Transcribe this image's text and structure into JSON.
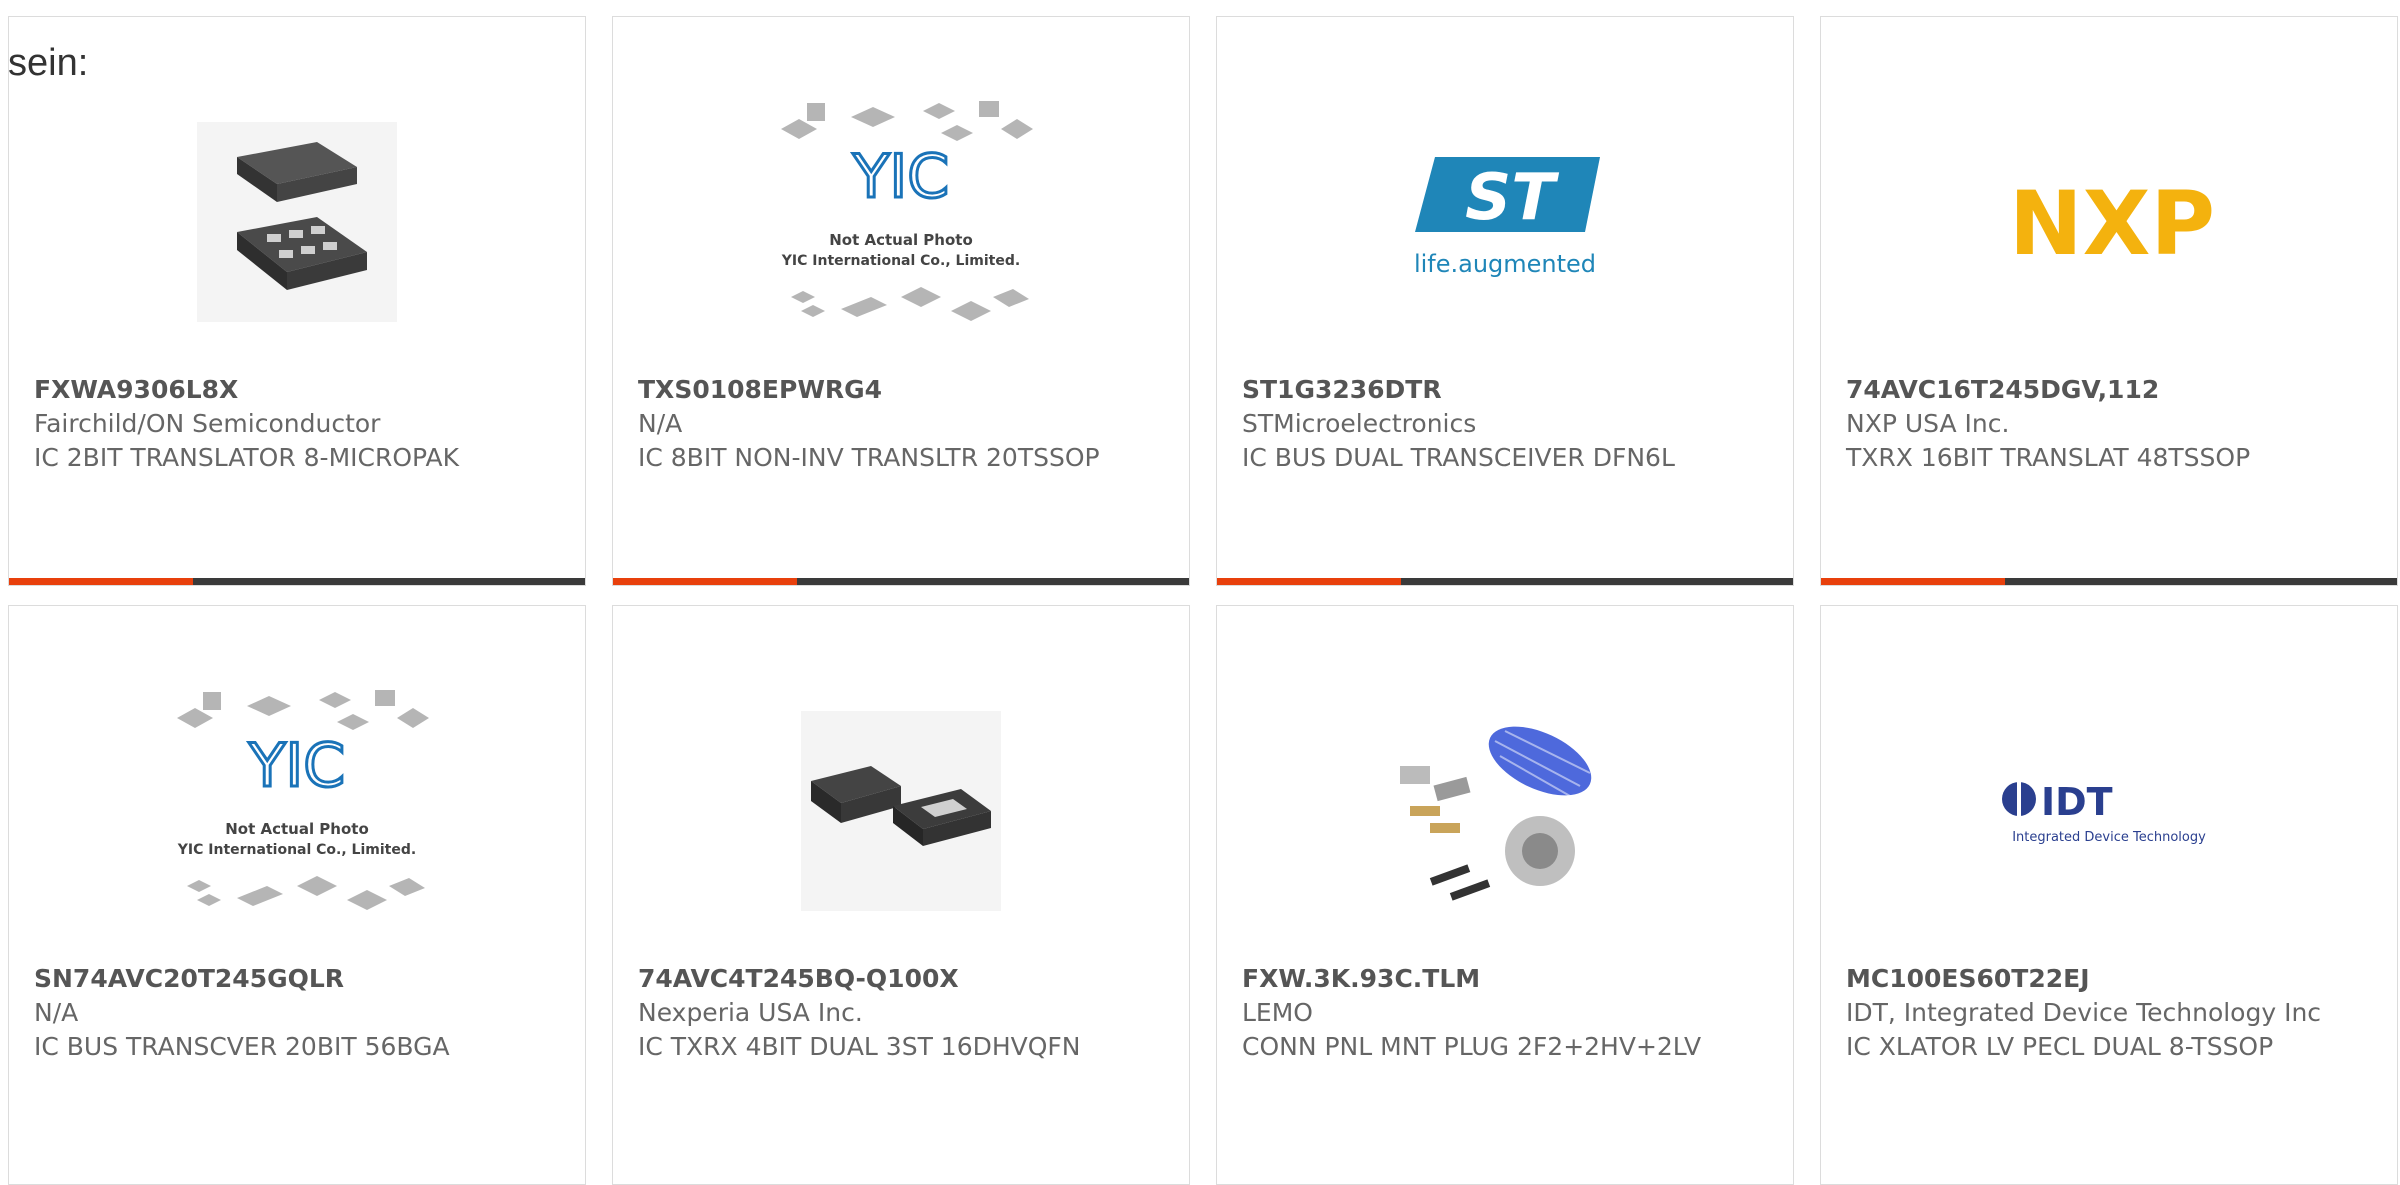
{
  "page": {
    "label": "sein:"
  },
  "products": [
    {
      "part": "FXWA9306L8X",
      "mfr": "Fairchild/ON Semiconductor",
      "desc": "IC 2BIT TRANSLATOR 8-MICROPAK",
      "image": "chip-8-micropak"
    },
    {
      "part": "TXS0108EPWRG4",
      "mfr": "N/A",
      "desc": "IC 8BIT NON-INV TRANSLTR 20TSSOP",
      "image": "yic-placeholder",
      "image_text": [
        "YIC",
        "Not Actual Photo",
        "YIC International Co., Limited."
      ]
    },
    {
      "part": "ST1G3236DTR",
      "mfr": "STMicroelectronics",
      "desc": "IC BUS DUAL TRANSCEIVER DFN6L",
      "image": "st-logo",
      "image_text": [
        "ST",
        "life.augmented"
      ]
    },
    {
      "part": "74AVC16T245DGV,112",
      "mfr": "NXP USA Inc.",
      "desc": "TXRX 16BIT TRANSLAT 48TSSOP",
      "image": "nxp-logo",
      "image_text": [
        "NXP"
      ]
    },
    {
      "part": "SN74AVC20T245GQLR",
      "mfr": "N/A",
      "desc": "IC BUS TRANSCVER 20BIT 56BGA",
      "image": "yic-placeholder",
      "image_text": [
        "YIC",
        "Not Actual Photo",
        "YIC International Co., Limited."
      ]
    },
    {
      "part": "74AVC4T245BQ-Q100X",
      "mfr": "Nexperia USA Inc.",
      "desc": "IC TXRX 4BIT DUAL 3ST 16DHVQFN",
      "image": "chip-dhvqfn"
    },
    {
      "part": "FXW.3K.93C.TLM",
      "mfr": "LEMO",
      "desc": "CONN PNL MNT PLUG 2F2+2HV+2LV",
      "image": "connector-parts"
    },
    {
      "part": "MC100ES60T22EJ",
      "mfr": "IDT, Integrated Device Technology Inc",
      "desc": "IC XLATOR LV PECL DUAL 8-TSSOP",
      "image": "idt-logo",
      "image_text": [
        "IDT",
        "Integrated Device Technology"
      ]
    }
  ],
  "colors": {
    "accent": "#e8400c",
    "bar": "#3a3a3a",
    "yic_blue": "#1a73b8"
  }
}
